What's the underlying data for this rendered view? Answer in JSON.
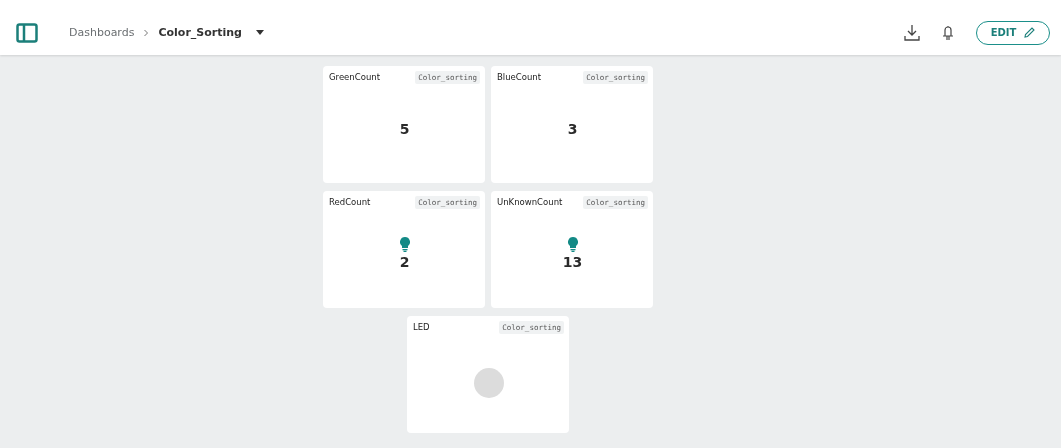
{
  "header": {
    "breadcrumb": [
      {
        "label": "Dashboards",
        "current": false
      },
      {
        "label": "Color_Sorting",
        "current": true
      }
    ],
    "edit_button": "EDIT"
  },
  "widgets": [
    {
      "kind": "value",
      "title": "GreenCount",
      "tag": "Color_sorting",
      "value": "5"
    },
    {
      "kind": "value",
      "title": "BlueCount",
      "tag": "Color_sorting",
      "value": "3"
    },
    {
      "kind": "bulb_value",
      "title": "RedCount",
      "tag": "Color_sorting",
      "value": "2"
    },
    {
      "kind": "bulb_value",
      "title": "UnKnownCount",
      "tag": "Color_sorting",
      "value": "13"
    },
    {
      "kind": "led",
      "title": "LED",
      "tag": "Color_sorting",
      "on": false
    }
  ]
}
